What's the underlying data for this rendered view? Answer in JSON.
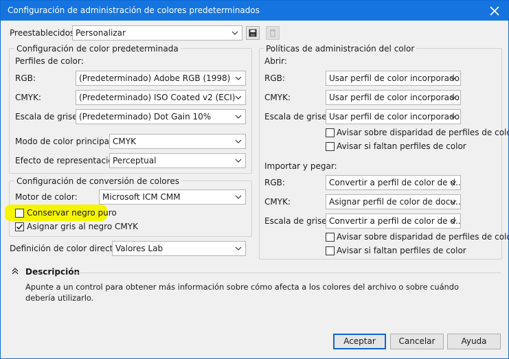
{
  "window": {
    "title": "Configuración de administración de colores predeterminados"
  },
  "presets": {
    "label": "Preestablecidos:",
    "value": "Personalizar"
  },
  "default_color": {
    "title": "Configuración de color predeterminada",
    "profiles_label": "Perfiles de color:",
    "rgb": {
      "label": "RGB:",
      "value": "(Predeterminado) Adobe RGB (1998)"
    },
    "cmyk": {
      "label": "CMYK:",
      "value": "(Predeterminado) ISO Coated v2 (ECI)"
    },
    "gray": {
      "label": "Escala de grises:",
      "value": "(Predeterminado) Dot Gain 10%"
    },
    "primary_mode": {
      "label": "Modo de color principal:",
      "value": "CMYK"
    },
    "rendering": {
      "label": "Efecto de representación:",
      "value": "Perceptual"
    }
  },
  "conversion": {
    "title": "Configuración de conversión de colores",
    "engine": {
      "label": "Motor de color:",
      "value": "Microsoft ICM CMM"
    },
    "preserve_black": {
      "label": "Conservar negro puro",
      "checked": false
    },
    "map_gray": {
      "label": "Asignar gris al negro CMYK",
      "checked": true
    }
  },
  "spot": {
    "label": "Definición de color directo:",
    "value": "Valores Lab"
  },
  "policies": {
    "title": "Políticas de administración del color",
    "open": {
      "label": "Abrir:",
      "rgb": {
        "label": "RGB:",
        "value": "Usar perfil de color incorporado"
      },
      "cmyk": {
        "label": "CMYK:",
        "value": "Usar perfil de color incorporado"
      },
      "gray": {
        "label": "Escala de grises:",
        "value": "Usar perfil de color incorporado"
      },
      "warn_mismatch": {
        "label": "Avisar sobre disparidad de perfiles de color",
        "checked": false
      },
      "warn_missing": {
        "label": "Avisar si faltan perfiles de color",
        "checked": false
      }
    },
    "paste": {
      "label": "Importar y pegar:",
      "rgb": {
        "label": "RGB:",
        "value": "Convertir a perfil de color de d..."
      },
      "cmyk": {
        "label": "CMYK:",
        "value": "Asignar perfil de color de docu..."
      },
      "gray": {
        "label": "Escala de grises:",
        "value": "Convertir a perfil de color de d..."
      },
      "warn_mismatch": {
        "label": "Avisar sobre disparidad de perfiles de color",
        "checked": false
      },
      "warn_missing": {
        "label": "Avisar si faltan perfiles de color",
        "checked": false
      }
    }
  },
  "description": {
    "title": "Descripción",
    "line1": "Apunte a un control para obtener más información sobre cómo afecta a los colores del archivo o sobre cuándo",
    "line2": "debería utilizarlo."
  },
  "buttons": {
    "accept": "Aceptar",
    "cancel": "Cancelar",
    "help": "Ayuda"
  },
  "colors": {
    "titlebar": "#1574df",
    "highlight": "#f5f500",
    "accent": "#0a64d0"
  },
  "icons": {
    "close": "close-icon",
    "save": "save-icon",
    "delete": "delete-icon",
    "collapse": "chevron-up-double-icon"
  }
}
